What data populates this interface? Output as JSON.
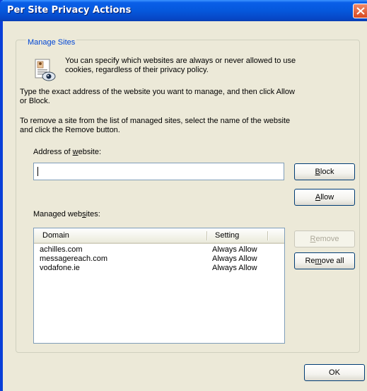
{
  "window": {
    "title": "Per Site Privacy Actions"
  },
  "group": {
    "legend": "Manage Sites"
  },
  "intro": {
    "line1": "You can specify which websites are always or never allowed to use",
    "line2": "cookies, regardless of their privacy policy."
  },
  "instructions": {
    "type_line1": "Type the exact address of the website you want to manage, and then click Allow",
    "type_line2": "or Block.",
    "remove_line1": "To remove a site from the list of managed sites, select the name of the website",
    "remove_line2": "and click the Remove button."
  },
  "address": {
    "label_pre": "Address of ",
    "label_key": "w",
    "label_post": "ebsite:",
    "value": ""
  },
  "buttons": {
    "block": {
      "key": "B",
      "rest": "lock"
    },
    "allow": {
      "key": "A",
      "rest": "llow"
    },
    "remove": {
      "key": "R",
      "rest": "emove",
      "enabled": false
    },
    "remove_all": {
      "pre": "Re",
      "key": "m",
      "rest": "ove all"
    },
    "ok": "OK"
  },
  "managed": {
    "label_pre": "Managed web",
    "label_key": "s",
    "label_post": "ites:",
    "columns": [
      "Domain",
      "Setting"
    ],
    "rows": [
      {
        "domain": "achilles.com",
        "setting": "Always Allow"
      },
      {
        "domain": "messagereach.com",
        "setting": "Always Allow"
      },
      {
        "domain": "vodafone.ie",
        "setting": "Always Allow"
      }
    ]
  },
  "colors": {
    "title_bar": "#0558dc",
    "dialog_bg": "#ece9d8",
    "legend_text": "#0046d5",
    "close_button": "#d84920"
  }
}
